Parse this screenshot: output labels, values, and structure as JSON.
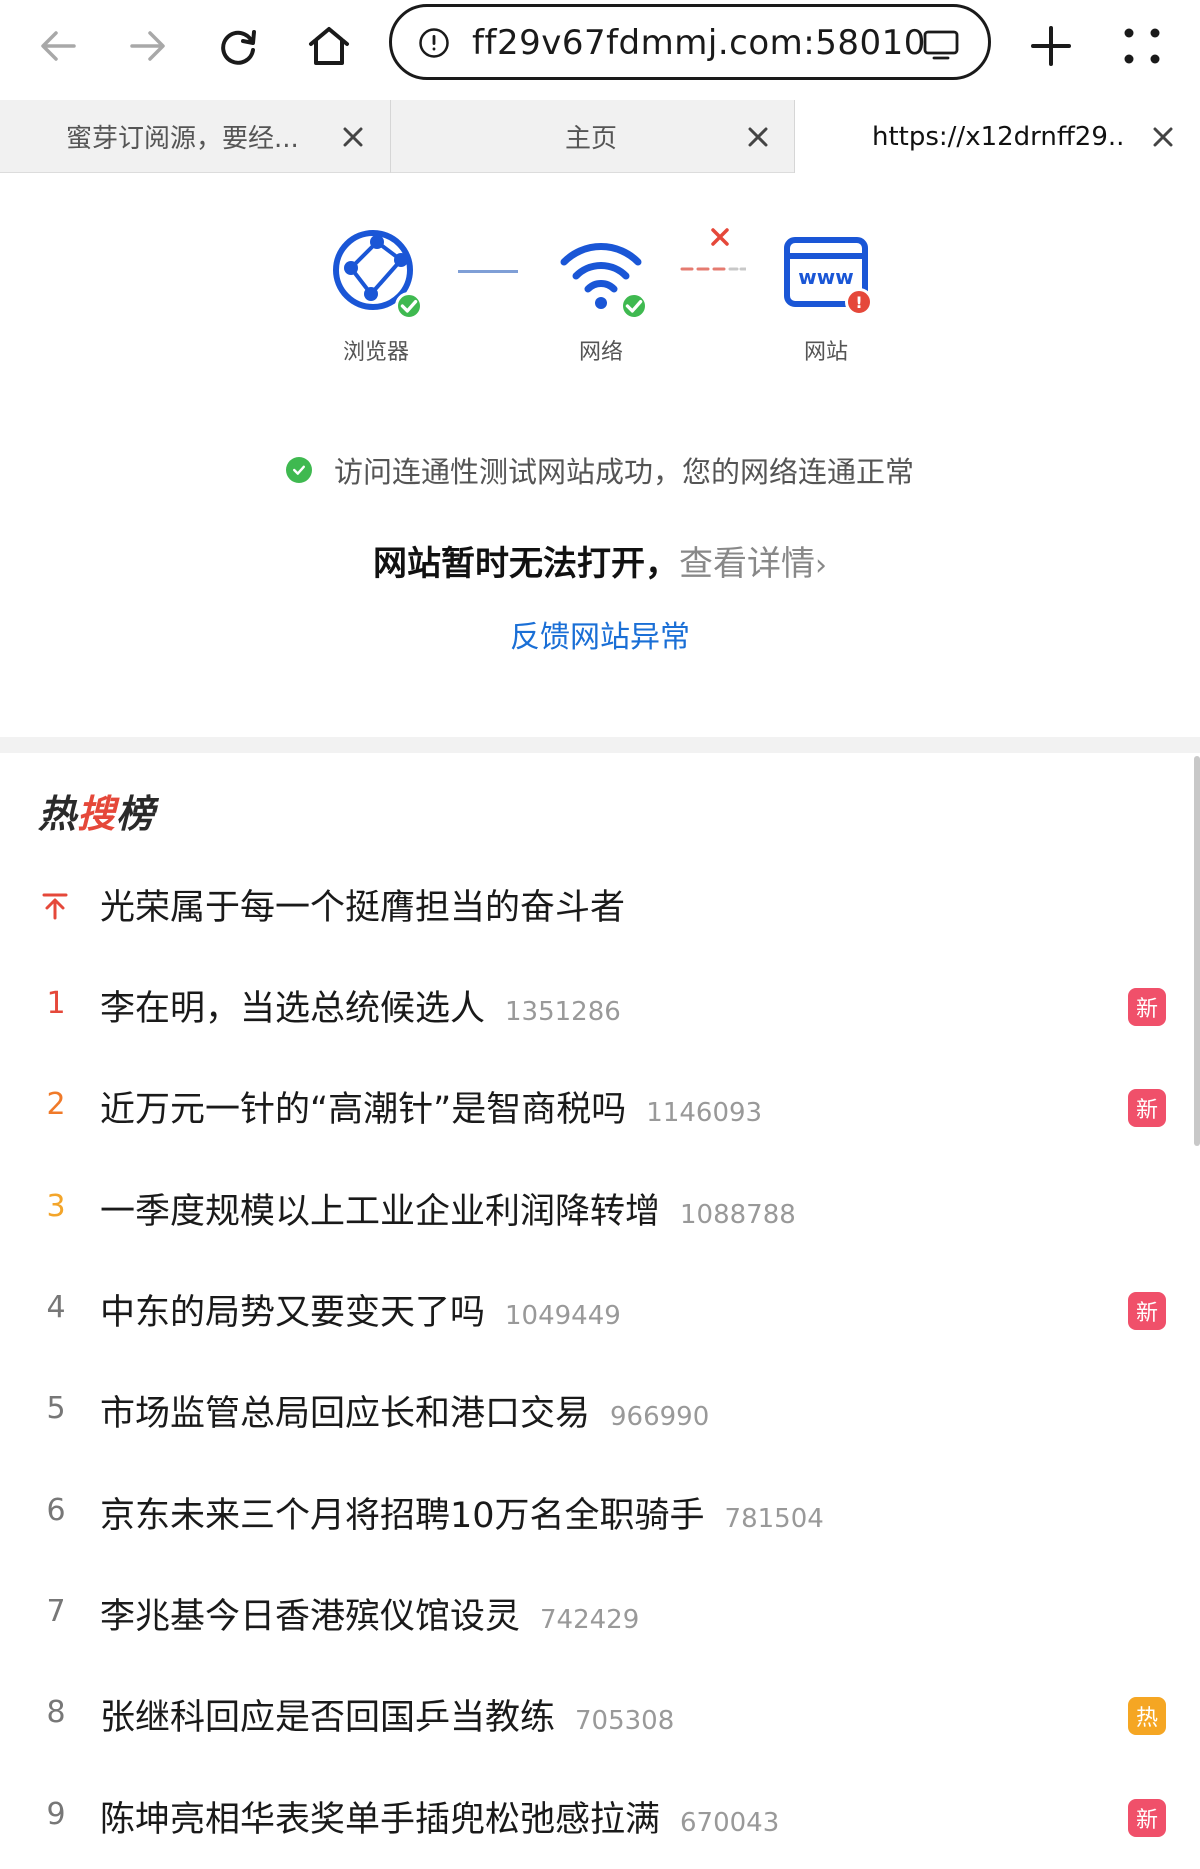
{
  "browser": {
    "url": "ff29v67fdmmj.com:58010",
    "back_icon": "back-arrow-icon",
    "forward_icon": "forward-arrow-icon",
    "reload_icon": "reload-icon",
    "home_icon": "home-icon",
    "info_icon": "info-icon",
    "screen_icon": "screen-icon",
    "new_tab_icon": "plus-icon",
    "menu_icon": "grid-dots-icon"
  },
  "tabs": [
    {
      "title": "蜜芽订阅源，要经...",
      "active": false
    },
    {
      "title": "主页",
      "active": false
    },
    {
      "title": "https://x12drnff29...",
      "active": true
    }
  ],
  "diagnostics": {
    "nodes": [
      {
        "label": "浏览器",
        "status": "ok"
      },
      {
        "label": "网络",
        "status": "ok"
      },
      {
        "label": "网站",
        "status": "error"
      }
    ],
    "website_icon_text": "www",
    "error_mark": "!",
    "status_message": "访问连通性测试网站成功，您的网络连通正常",
    "headline_main": "网站暂时无法打开，",
    "headline_link": "查看详情",
    "headline_chevron": "›",
    "feedback_link": "反馈网站异常",
    "colors": {
      "ok": "#3fb950",
      "error": "#e5483a",
      "link": "#1a6fd6",
      "accent": "#1a56d6"
    }
  },
  "hot_search": {
    "title_part1": "热",
    "title_part2": "搜",
    "title_part3": "榜",
    "pinned": {
      "rank_icon": "pin-top-icon",
      "text": "光荣属于每一个挺膺担当的奋斗者"
    },
    "items": [
      {
        "rank": "1",
        "text": "李在明，当选总统候选人",
        "count": "1351286",
        "tag": "新"
      },
      {
        "rank": "2",
        "text": "近万元一针的“高潮针”是智商税吗",
        "count": "1146093",
        "tag": "新"
      },
      {
        "rank": "3",
        "text": "一季度规模以上工业企业利润降转增",
        "count": "1088788",
        "tag": ""
      },
      {
        "rank": "4",
        "text": "中东的局势又要变天了吗",
        "count": "1049449",
        "tag": "新"
      },
      {
        "rank": "5",
        "text": "市场监管总局回应长和港口交易",
        "count": "966990",
        "tag": ""
      },
      {
        "rank": "6",
        "text": "京东未来三个月将招聘10万名全职骑手",
        "count": "781504",
        "tag": ""
      },
      {
        "rank": "7",
        "text": "李兆基今日香港殡仪馆设灵",
        "count": "742429",
        "tag": ""
      },
      {
        "rank": "8",
        "text": "张继科回应是否回国乒当教练",
        "count": "705308",
        "tag": "热"
      },
      {
        "rank": "9",
        "text": "陈坤亮相华表奖单手插兜松弛感拉满",
        "count": "670043",
        "tag": "新"
      }
    ],
    "tag_colors": {
      "新": "#f0506a",
      "热": "#f5a623"
    }
  }
}
